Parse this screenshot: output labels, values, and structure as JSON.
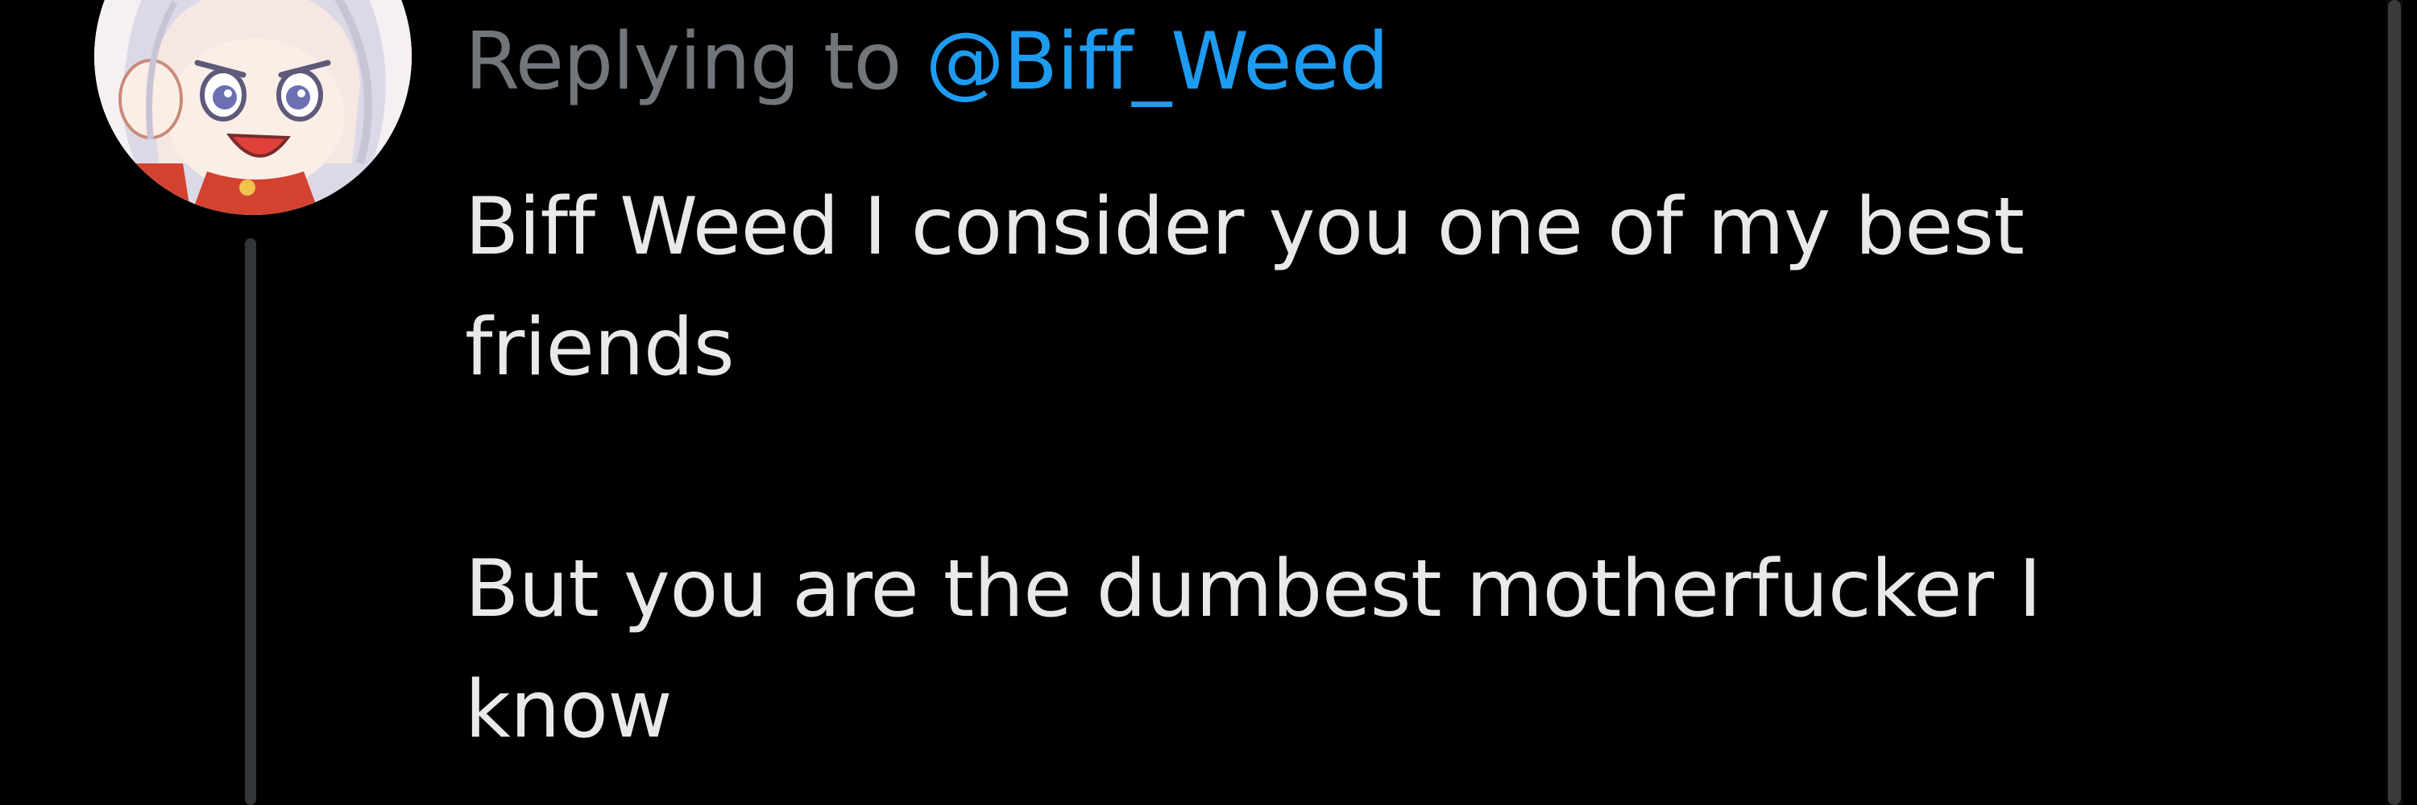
{
  "reply": {
    "prefix": "Replying to ",
    "handle": "@Biff_Weed"
  },
  "tweet": {
    "lines": [
      "Biff Weed I consider you one of my best",
      "friends",
      "",
      "But you are the dumbest motherfucker I",
      "know"
    ]
  },
  "avatar": {
    "icon": "anime-character-avatar",
    "description_colors": {
      "background": "#f7f2f6",
      "hair": "#d9d6e2",
      "eyes": "#6d6fb3",
      "mouth": "#e2403a",
      "outfit": "#d3422f"
    }
  },
  "colors": {
    "background": "#000000",
    "text": "#e7e9ea",
    "muted": "#71767b",
    "link": "#1d9bf0",
    "thread_line": "#333639"
  }
}
